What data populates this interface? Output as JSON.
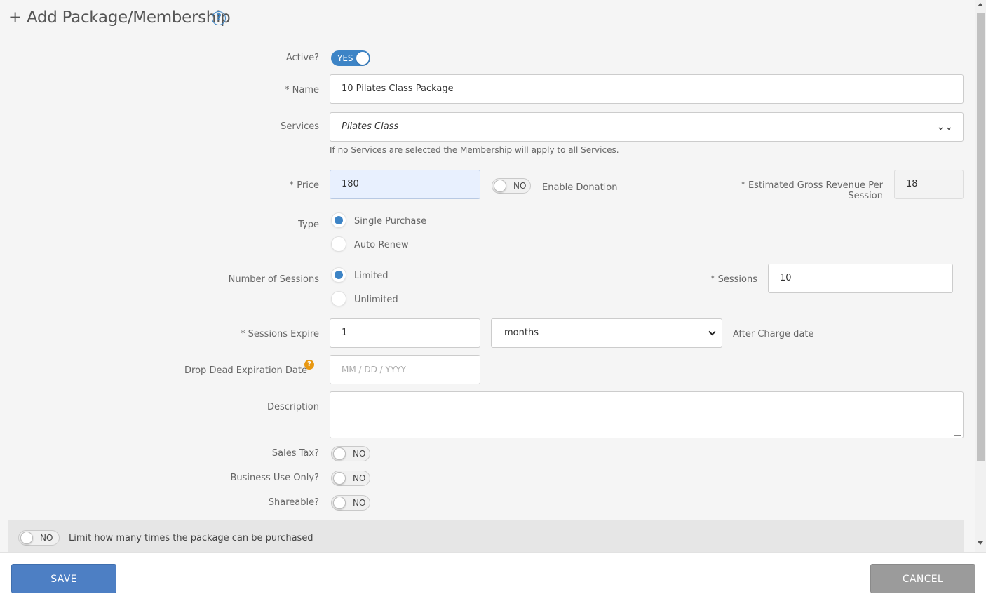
{
  "header": {
    "title": "+ Add Package/Membership",
    "help_icon": "?"
  },
  "form": {
    "active": {
      "label": "Active?",
      "toggle_text": "YES"
    },
    "name": {
      "label": "* Name",
      "value": "10 Pilates Class Package"
    },
    "services": {
      "label": "Services",
      "value": "Pilates Class",
      "dropdown_icon": "⌄⌄",
      "hint": "If no Services are selected the Membership will apply to all Services."
    },
    "price": {
      "label": "* Price",
      "value": "180",
      "donation_toggle": "NO",
      "donation_label": "Enable Donation",
      "gross_revenue_label_1": "* Estimated Gross Revenue Per",
      "gross_revenue_label_2": "Session",
      "gross_revenue_value": "18"
    },
    "type": {
      "label": "Type",
      "options": [
        "Single Purchase",
        "Auto Renew"
      ],
      "selected": "Single Purchase"
    },
    "number_of_sessions": {
      "label": "Number of Sessions",
      "options": [
        "Limited",
        "Unlimited"
      ],
      "selected": "Limited",
      "sessions_label": "* Sessions",
      "sessions_value": "10"
    },
    "sessions_expire": {
      "label": "* Sessions Expire",
      "value": "1",
      "unit": "months",
      "suffix": "After Charge date"
    },
    "drop_dead": {
      "label": "Drop Dead Expiration Date",
      "help_icon": "?",
      "placeholder": "MM / DD / YYYY"
    },
    "description": {
      "label": "Description",
      "value": ""
    },
    "sales_tax": {
      "label": "Sales Tax?",
      "toggle_text": "NO"
    },
    "business_use": {
      "label": "Business Use Only?",
      "toggle_text": "NO"
    },
    "shareable": {
      "label": "Shareable?",
      "toggle_text": "NO"
    },
    "limit": {
      "toggle_text": "NO",
      "label": "Limit how many times the package can be purchased"
    }
  },
  "footer": {
    "save_label": "SAVE",
    "cancel_label": "CANCEL"
  },
  "colors": {
    "accent": "#3d84c6",
    "save_button": "#4d7fc4",
    "cancel_button": "#9b9b9b",
    "help_orange": "#e89812"
  }
}
